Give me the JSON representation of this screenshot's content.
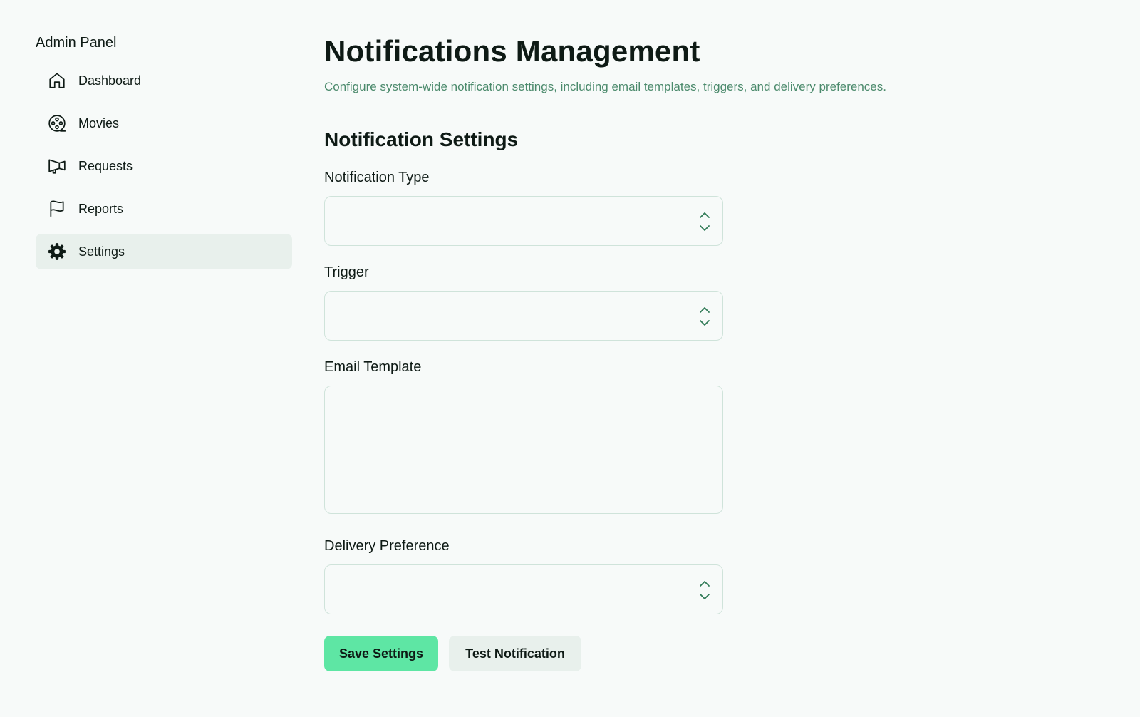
{
  "sidebar": {
    "brand": "Admin Panel",
    "items": [
      {
        "label": "Dashboard",
        "icon": "home-icon"
      },
      {
        "label": "Movies",
        "icon": "film-reel-icon"
      },
      {
        "label": "Requests",
        "icon": "megaphone-icon"
      },
      {
        "label": "Reports",
        "icon": "flag-icon"
      },
      {
        "label": "Settings",
        "icon": "gear-icon",
        "active": true
      }
    ]
  },
  "main": {
    "title": "Notifications Management",
    "subtitle": "Configure system-wide notification settings, including email templates, triggers, and delivery preferences.",
    "section_title": "Notification Settings",
    "fields": {
      "notification_type": {
        "label": "Notification Type",
        "value": ""
      },
      "trigger": {
        "label": "Trigger",
        "value": ""
      },
      "email_template": {
        "label": "Email Template",
        "value": ""
      },
      "delivery_preference": {
        "label": "Delivery Preference",
        "value": ""
      }
    },
    "buttons": {
      "save": "Save Settings",
      "test": "Test Notification"
    }
  },
  "colors": {
    "background": "#f7faf9",
    "accent": "#5ee6a4",
    "subtitle": "#4b8a6c",
    "active_nav": "#e8f0ec",
    "border": "#cfe3da"
  }
}
